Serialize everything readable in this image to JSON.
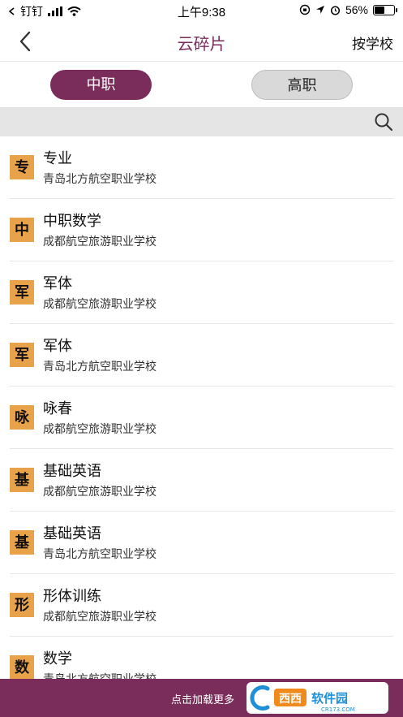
{
  "status_bar": {
    "carrier": "钉钉",
    "time": "上午9:38",
    "battery_percent": "56%",
    "battery_level": 0.56
  },
  "nav": {
    "title": "云碎片",
    "right_label": "按学校"
  },
  "tabs": [
    {
      "label": "中职",
      "active": true
    },
    {
      "label": "高职",
      "active": false
    }
  ],
  "items": [
    {
      "badge": "专",
      "title": "专业",
      "school": "青岛北方航空职业学校"
    },
    {
      "badge": "中",
      "title": "中职数学",
      "school": "成都航空旅游职业学校"
    },
    {
      "badge": "军",
      "title": "军体",
      "school": "成都航空旅游职业学校"
    },
    {
      "badge": "军",
      "title": "军体",
      "school": "青岛北方航空职业学校"
    },
    {
      "badge": "咏",
      "title": "咏春",
      "school": "成都航空旅游职业学校"
    },
    {
      "badge": "基",
      "title": "基础英语",
      "school": "成都航空旅游职业学校"
    },
    {
      "badge": "基",
      "title": "基础英语",
      "school": "青岛北方航空职业学校"
    },
    {
      "badge": "形",
      "title": "形体训练",
      "school": "成都航空旅游职业学校"
    },
    {
      "badge": "数",
      "title": "数学",
      "school": "青岛北方航空职业学校"
    }
  ],
  "footer": {
    "load_more": "点击加载更多",
    "watermark_text": "西西软件园",
    "watermark_sub": "CR173.COM"
  },
  "colors": {
    "accent": "#7a2d5b",
    "badge": "#e8a24a",
    "search_bg": "#e5e5e5"
  }
}
